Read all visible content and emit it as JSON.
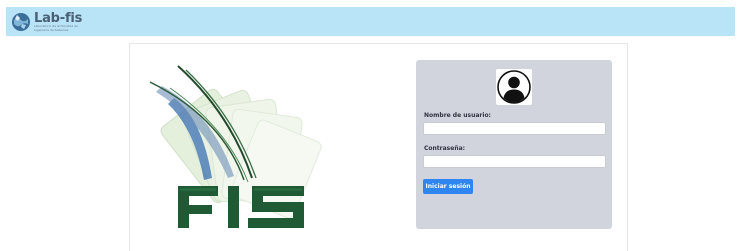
{
  "header": {
    "logo_name": "Lab-fis",
    "logo_subtitle": "Laboratorio de la Facultad de Ingeniería de Sistemas"
  },
  "branding": {
    "art_text": "FIS",
    "colors": {
      "header_bg": "#b9e3f6",
      "panel_bg": "#d1d4dc",
      "button_bg": "#2f86f0",
      "logo_green": "#1f5a34"
    }
  },
  "login": {
    "username_label": "Nombre de usuario:",
    "username_value": "",
    "password_label": "Contraseña:",
    "password_value": "",
    "submit_label": "Iniciar sesión",
    "avatar_icon": "user-avatar-icon"
  }
}
